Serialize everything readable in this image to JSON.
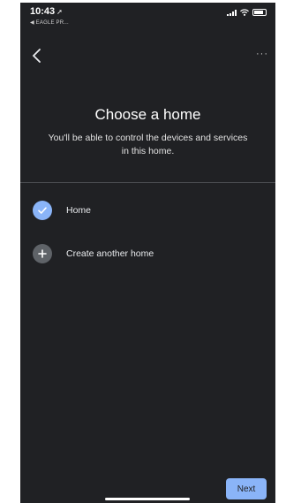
{
  "status_bar": {
    "time": "10:43",
    "back_app": "◀ EAGLE PR..."
  },
  "header": {
    "back_icon": "chevron-left-icon",
    "more_label": "···"
  },
  "main": {
    "title": "Choose a home",
    "subtitle": "You'll be able to control the devices and services in this home."
  },
  "homes": [
    {
      "label": "Home",
      "icon": "check-icon",
      "selected": true
    },
    {
      "label": "Create another home",
      "icon": "plus-icon",
      "selected": false
    }
  ],
  "footer": {
    "next_label": "Next"
  },
  "colors": {
    "background": "#202124",
    "accent": "#8ab4f8",
    "add_circle": "#5f6368"
  }
}
